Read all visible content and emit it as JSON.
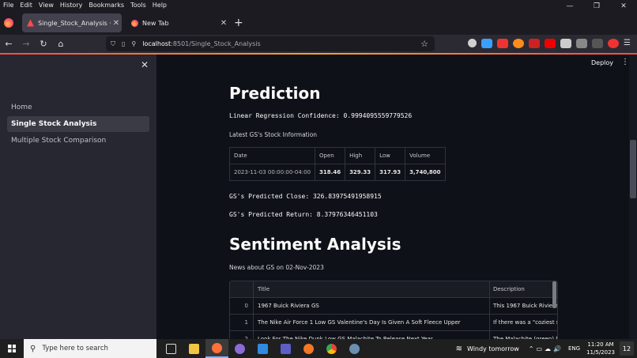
{
  "browser": {
    "menu": [
      "File",
      "Edit",
      "View",
      "History",
      "Bookmarks",
      "Tools",
      "Help"
    ],
    "tabs": [
      {
        "title": "Single_Stock_Analysis · Streamlit",
        "active": true
      },
      {
        "title": "New Tab",
        "active": false
      }
    ],
    "url_host": "localhost",
    "url_path": ":8501/Single_Stock_Analysis"
  },
  "sidebar": {
    "items": [
      {
        "label": "Home",
        "selected": false
      },
      {
        "label": "Single Stock Analysis",
        "selected": true
      },
      {
        "label": "Multiple Stock Comparison",
        "selected": false
      }
    ]
  },
  "app_header": {
    "deploy_label": "Deploy"
  },
  "prediction": {
    "heading": "Prediction",
    "confidence": "Linear Regression Confidence: 0.9994095559779526",
    "latest_caption": "Latest GS's Stock Information",
    "table": {
      "columns": [
        "Date",
        "Open",
        "High",
        "Low",
        "Volume"
      ],
      "row": [
        "2023-11-03 00:00:00-04:00",
        "318.46",
        "329.33",
        "317.93",
        "3,740,800"
      ]
    },
    "predicted_close": "GS's Predicted Close: 326.83975491958915",
    "predicted_return": "GS's Predicted Return: 8.37976346451103"
  },
  "sentiment": {
    "heading": "Sentiment Analysis",
    "caption": "News about GS on 02-Nov-2023",
    "columns": [
      "",
      "Title",
      "Description"
    ],
    "rows": [
      {
        "idx": "0",
        "title": "1967 Buick Riviera GS",
        "desc": "This 1967 Buick Riviera"
      },
      {
        "idx": "1",
        "title": "The Nike Air Force 1 Low GS Valentine's Day Is Given A Soft Fleece Upper",
        "desc": "If there was a \"coziest s"
      },
      {
        "idx": "2",
        "title": "Look For The Nike Dunk Low GS Malachite To Release Next Year",
        "desc": "The Malachite (green) h"
      }
    ]
  },
  "taskbar": {
    "search_placeholder": "Type here to search",
    "weather": "Windy tomorrow",
    "lang": "ENG",
    "time": "11:20 AM",
    "date": "11/5/2023",
    "notif_count": "12"
  },
  "colors": {
    "accent": "#ff4b4b",
    "app_bg": "#0e1117",
    "sidebar_bg": "#262730"
  }
}
